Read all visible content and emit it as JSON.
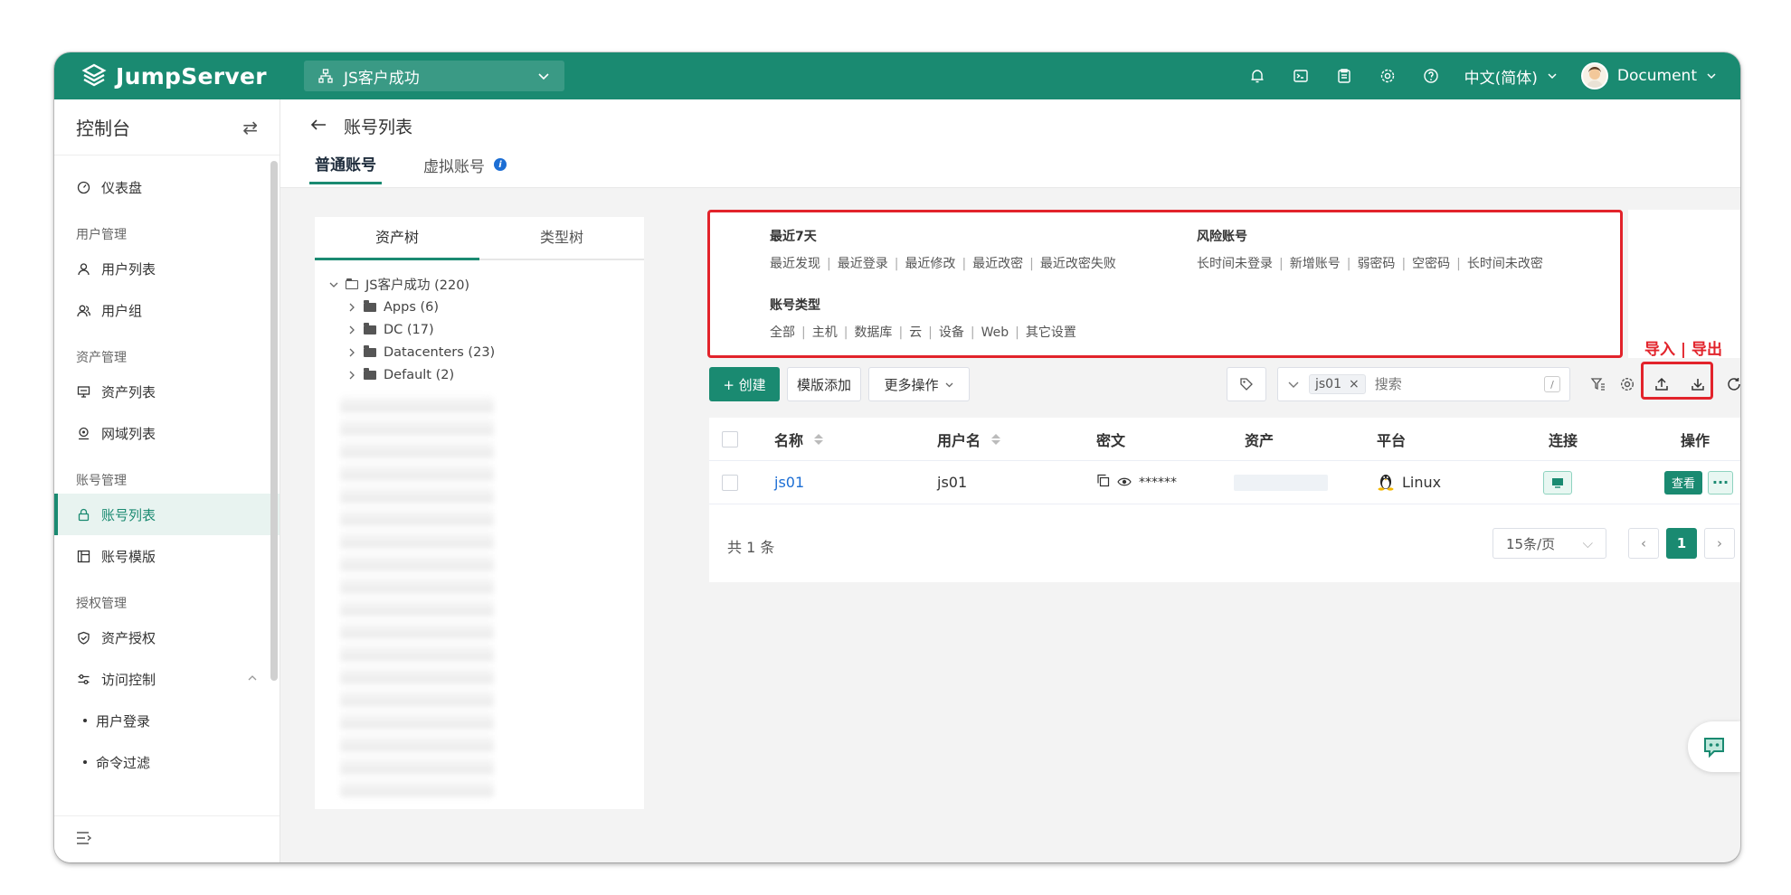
{
  "header": {
    "logo_text": "JumpServer",
    "org_name": "JS客户成功",
    "language": "中文(简体)",
    "username": "Document"
  },
  "sidebar": {
    "title": "控制台",
    "dashboard": "仪表盘",
    "groups": {
      "user_mgmt": "用户管理",
      "asset_mgmt": "资产管理",
      "account_mgmt": "账号管理",
      "perm_mgmt": "授权管理"
    },
    "items": {
      "user_list": "用户列表",
      "user_group": "用户组",
      "asset_list": "资产列表",
      "domain_list": "网域列表",
      "account_list": "账号列表",
      "account_template": "账号模版",
      "asset_perm": "资产授权",
      "access_control": "访问控制",
      "user_login": "用户登录",
      "command_filter": "命令过滤"
    }
  },
  "page": {
    "title": "账号列表",
    "tabs": {
      "normal": "普通账号",
      "virtual": "虚拟账号"
    }
  },
  "tree": {
    "tabs": {
      "asset_tree": "资产树",
      "type_tree": "类型树"
    },
    "root": "JS客户成功 (220)",
    "children": [
      "Apps (6)",
      "DC (17)",
      "Datacenters (23)",
      "Default (2)"
    ]
  },
  "filters": {
    "recent": {
      "title": "最近7天",
      "links": [
        "最近发现",
        "最近登录",
        "最近修改",
        "最近改密",
        "最近改密失败"
      ]
    },
    "risk": {
      "title": "风险账号",
      "links": [
        "长时间未登录",
        "新增账号",
        "弱密码",
        "空密码",
        "长时间未改密"
      ]
    },
    "types": {
      "title": "账号类型",
      "links": [
        "全部",
        "主机",
        "数据库",
        "云",
        "设备",
        "Web",
        "其它设置"
      ]
    }
  },
  "annotation": {
    "import_export": "导入 | 导出"
  },
  "toolbar": {
    "create": "+ 创建",
    "template_add": "模版添加",
    "more_actions": "更多操作",
    "search_chip": "js01",
    "search_placeholder": "搜索",
    "shortcut": "/"
  },
  "table": {
    "columns": {
      "name": "名称",
      "username": "用户名",
      "secret": "密文",
      "asset": "资产",
      "platform": "平台",
      "connect": "连接",
      "actions": "操作"
    },
    "rows": [
      {
        "name": "js01",
        "username": "js01",
        "secret": "******",
        "platform": "Linux",
        "view": "查看",
        "more": "···"
      }
    ],
    "total": "共 1 条",
    "page_size": "15条/页",
    "current_page": "1"
  },
  "colors": {
    "brand": "#1a8a71",
    "highlight_red": "#e2232b",
    "link": "#1c6ed4"
  }
}
